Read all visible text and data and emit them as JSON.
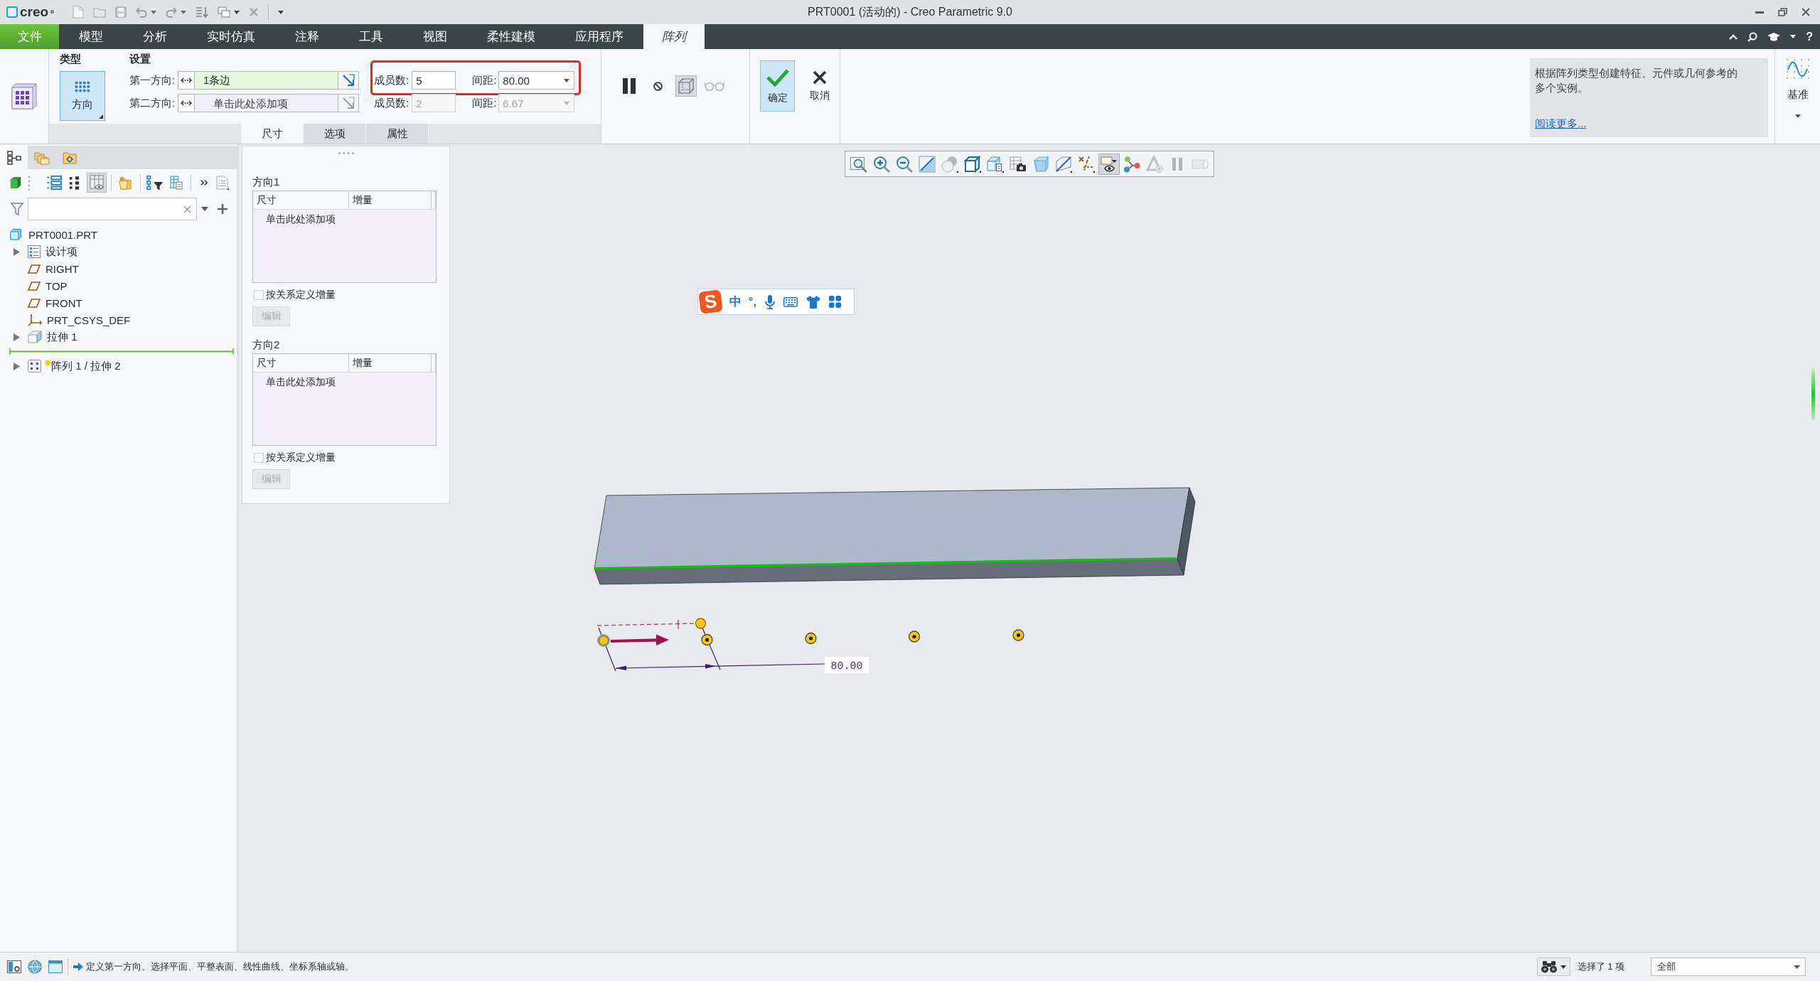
{
  "title_bar": {
    "logo": "creo",
    "title": "PRT0001 (活动的) - Creo Parametric 9.0"
  },
  "menu": {
    "tabs": [
      {
        "label": "文件",
        "kind": "file",
        "selected": false
      },
      {
        "label": "模型",
        "kind": "tab",
        "selected": false
      },
      {
        "label": "分析",
        "kind": "tab",
        "selected": false
      },
      {
        "label": "实时仿真",
        "kind": "tab",
        "selected": false
      },
      {
        "label": "注释",
        "kind": "tab",
        "selected": false
      },
      {
        "label": "工具",
        "kind": "tab",
        "selected": false
      },
      {
        "label": "视图",
        "kind": "tab",
        "selected": false
      },
      {
        "label": "柔性建模",
        "kind": "tab",
        "selected": false
      },
      {
        "label": "应用程序",
        "kind": "tab",
        "selected": false
      },
      {
        "label": "阵列",
        "kind": "tab",
        "selected": true
      }
    ],
    "help": "?"
  },
  "ribbon": {
    "type_group": {
      "title": "类型",
      "buttons": [
        {
          "label": "方向",
          "selected": true
        }
      ]
    },
    "settings": {
      "title": "设置",
      "directions": [
        {
          "label": "第一方向:",
          "value": "1条边",
          "active": true,
          "members_label": "成员数:",
          "members": "5",
          "spacing_label": "间距:",
          "spacing": "80.00",
          "disabled": false,
          "highlighted": true
        },
        {
          "label": "第二方向:",
          "placeholder": "单击此处添加项",
          "active": false,
          "members_label": "成员数:",
          "members": "2",
          "spacing_label": "间距:",
          "spacing": "6.67",
          "disabled": true,
          "highlighted": false
        }
      ]
    },
    "tools": [
      {
        "on": false,
        "disabled": false
      },
      {
        "on": false,
        "disabled": false
      },
      {
        "on": true,
        "disabled": false
      },
      {
        "on": false,
        "disabled": true
      }
    ],
    "actions": [
      {
        "label": "确定",
        "kind": "ok",
        "highlighted": true
      },
      {
        "label": "取消",
        "kind": "cancel",
        "highlighted": false
      }
    ],
    "sub_tabs": [
      {
        "label": "尺寸",
        "selected": true
      },
      {
        "label": "选项",
        "selected": false
      },
      {
        "label": "属性",
        "selected": false
      }
    ],
    "info": {
      "text": "根据阵列类型创建特征、元件或几何参考的多个实例。",
      "link": "阅读更多..."
    },
    "datum": {
      "label": "基准"
    }
  },
  "sidebar": {
    "tabs": [
      {
        "selected": true
      },
      {
        "selected": false
      },
      {
        "selected": false
      }
    ],
    "tools": [
      {
        "on": false
      },
      {
        "on": false
      },
      {
        "on": false
      },
      {
        "on": true
      },
      {
        "on": false
      },
      {
        "on": false
      },
      {
        "on": false
      },
      {
        "on": false
      },
      {
        "on": false
      }
    ],
    "tree": {
      "label": "PRT0001.PRT",
      "kind": "part",
      "children": [
        {
          "label": "设计项",
          "kind": "folder",
          "expandable": true,
          "expanded": false,
          "active": false,
          "insert_below": false
        },
        {
          "label": "RIGHT",
          "kind": "plane",
          "expandable": false,
          "expanded": false,
          "active": false,
          "insert_below": false
        },
        {
          "label": "TOP",
          "kind": "plane",
          "expandable": false,
          "expanded": false,
          "active": false,
          "insert_below": false
        },
        {
          "label": "FRONT",
          "kind": "plane",
          "expandable": false,
          "expanded": false,
          "active": false,
          "insert_below": false
        },
        {
          "label": "PRT_CSYS_DEF",
          "kind": "csys",
          "expandable": false,
          "expanded": false,
          "active": false,
          "insert_below": false
        },
        {
          "label": "拉伸 1",
          "kind": "extrude",
          "expandable": true,
          "expanded": false,
          "active": false,
          "insert_below": true
        },
        {
          "label": "阵列 1 / 拉伸 2",
          "kind": "pattern",
          "expandable": true,
          "expanded": false,
          "active": true,
          "insert_below": false
        }
      ]
    }
  },
  "dims_panel": {
    "sections": [
      {
        "title": "方向1",
        "columns": [
          "尺寸",
          "增量"
        ],
        "prompt": "单击此处添加项",
        "checkbox": {
          "label": "按关系定义增量",
          "checked": false,
          "disabled": true
        },
        "button": {
          "label": "编辑",
          "disabled": true
        }
      },
      {
        "title": "方向2",
        "columns": [
          "尺寸",
          "增量"
        ],
        "prompt": "单击此处添加项",
        "checkbox": {
          "label": "按关系定义增量",
          "checked": false,
          "disabled": true
        },
        "button": {
          "label": "编辑",
          "disabled": true
        }
      }
    ]
  },
  "view_toolbar": [
    {
      "on": false,
      "disabled": false
    },
    {
      "on": false,
      "disabled": false
    },
    {
      "on": false,
      "disabled": false
    },
    {
      "on": false,
      "disabled": false
    },
    {
      "on": false,
      "disabled": false
    },
    {
      "on": false,
      "disabled": false
    },
    {
      "on": false,
      "disabled": false
    },
    {
      "on": false,
      "disabled": false
    },
    {
      "on": false,
      "disabled": false
    },
    {
      "on": false,
      "disabled": false
    },
    {
      "on": false,
      "disabled": false
    },
    {
      "on": true,
      "disabled": false
    },
    {
      "on": false,
      "disabled": false
    },
    {
      "on": false,
      "disabled": true
    },
    {
      "on": false,
      "disabled": true
    },
    {
      "on": false,
      "disabled": true
    }
  ],
  "ime_bar": {
    "logo": "S",
    "mode": "中",
    "punctuation": "°,"
  },
  "model": {
    "dimension": "80.00"
  },
  "status_bar": {
    "message": "定义第一方向。选择平面、平整表面、线性曲线、坐标系轴或轴。",
    "selection": "选择了 1 项",
    "filter": "全部"
  }
}
